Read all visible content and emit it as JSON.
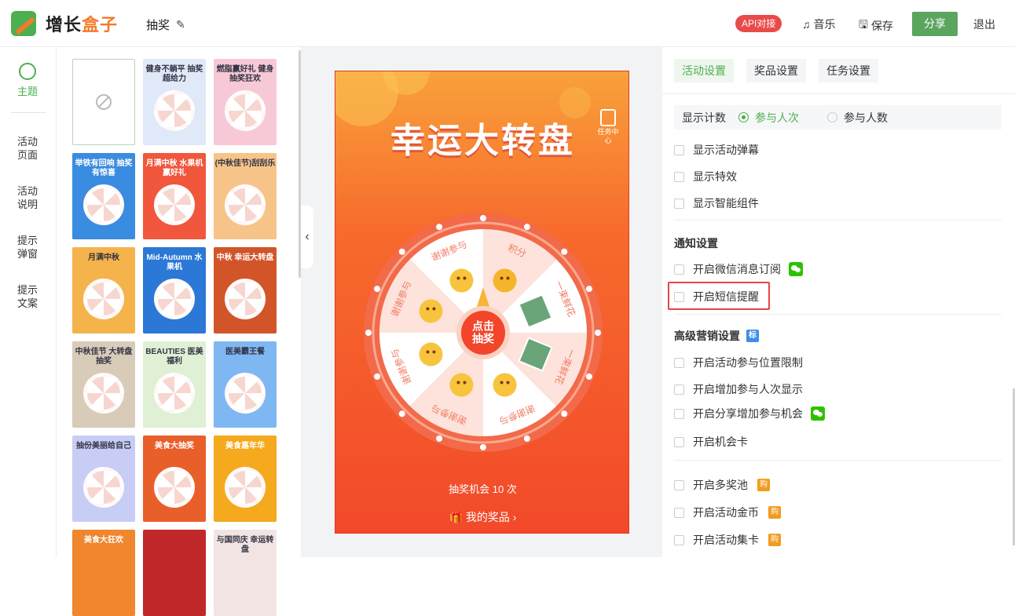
{
  "app": {
    "logo_part1": "增长",
    "logo_part2": "盒子",
    "doc_title": "抽奖"
  },
  "toolbar": {
    "api_label": "API对接",
    "music_label": "音乐",
    "save_label": "保存",
    "share_label": "分享",
    "exit_label": "退出"
  },
  "left_nav": {
    "theme_label": "主题",
    "items": [
      "活动\n页面",
      "活动\n说明",
      "提示\n弹窗",
      "提示\n文案"
    ]
  },
  "themes": {
    "items": [
      {
        "title": ""
      },
      {
        "title": "健身不躺平 抽奖超给力",
        "color": "#dfe9f7"
      },
      {
        "title": "燃脂赢好礼 健身抽奖狂欢",
        "color": "#f7c9d6"
      },
      {
        "title": "举铁有回响 抽奖有惊喜",
        "color": "#3a8ce0"
      },
      {
        "title": "月满中秋 水果机赢好礼",
        "color": "#f0573c"
      },
      {
        "title": "(中秋佳节)刮刮乐",
        "color": "#f6c489"
      },
      {
        "title": "月满中秋",
        "color": "#f5b34b"
      },
      {
        "title": "Mid-Autumn 水果机",
        "color": "#2c78d6"
      },
      {
        "title": "中秋 幸运大转盘",
        "color": "#d2552a"
      },
      {
        "title": "中秋佳节 大转盘抽奖",
        "color": "#d8cbb8"
      },
      {
        "title": "BEAUTIES 医美福利",
        "color": "#dff0d4"
      },
      {
        "title": "医美霸王餐",
        "color": "#7fb7f2"
      },
      {
        "title": "抽份美丽给自己",
        "color": "#c7cdf5"
      },
      {
        "title": "美食大抽奖",
        "color": "#e95f2a"
      },
      {
        "title": "美食嘉年华",
        "color": "#f5a91c"
      },
      {
        "title": "美食大狂欢",
        "color": "#f0862e"
      },
      {
        "title": "",
        "color": "#c1282a"
      },
      {
        "title": "与国同庆 幸运转盘",
        "color": "#f1e4e2"
      }
    ]
  },
  "preview": {
    "title": "幸运大转盘",
    "task_label": "任务中心",
    "center_button": "点击\n抽奖",
    "segments": [
      "积分",
      "一束鲜花",
      "一束鲜花",
      "谢谢参与",
      "谢谢参与",
      "谢谢参与",
      "谢谢参与",
      "谢谢参与"
    ],
    "chance_text": "抽奖机会 10 次",
    "my_prizes": "我的奖品"
  },
  "settings": {
    "tabs": [
      "活动设置",
      "奖品设置",
      "任务设置"
    ],
    "count_label": "显示计数",
    "count_opt1": "参与人次",
    "count_opt2": "参与人数",
    "opt_banner": "显示活动弹幕",
    "opt_effect": "显示特效",
    "opt_smart": "显示智能组件",
    "notify_title": "通知设置",
    "opt_wechat_sub": "开启微信消息订阅",
    "opt_sms": "开启短信提醒",
    "advanced_title": "高级营销设置",
    "advanced_badge": "标",
    "opt_location": "开启活动参与位置限制",
    "opt_add_count": "开启增加参与人次显示",
    "opt_share_more": "开启分享增加参与机会",
    "opt_chance_card": "开启机会卡",
    "opt_multi_pool": "开启多奖池",
    "opt_coins": "开启活动金币",
    "opt_collect": "开启活动集卡",
    "buy_badge": "购"
  },
  "colors": {
    "accent": "#4caf50",
    "brand_orange": "#f47a2b",
    "api_red": "#e94b4b",
    "highlight_red": "#e64545"
  }
}
